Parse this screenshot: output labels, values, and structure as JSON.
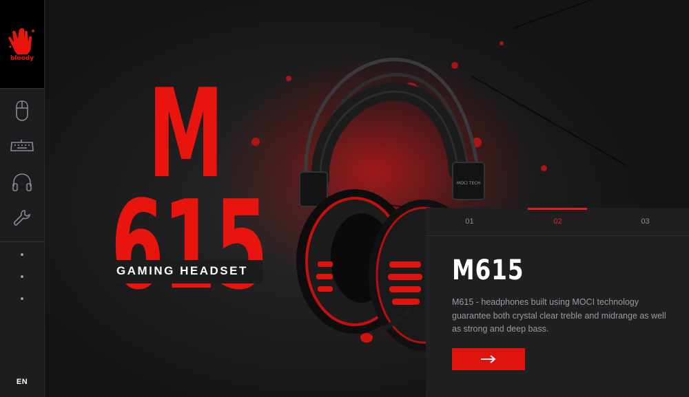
{
  "brand": {
    "logo_text": "bloody",
    "accent": "#e1130e"
  },
  "sidebar": {
    "icons": [
      {
        "name": "mouse-icon"
      },
      {
        "name": "keyboard-icon"
      },
      {
        "name": "headset-icon"
      },
      {
        "name": "wrench-icon"
      }
    ],
    "dots_count": 3,
    "language": "EN"
  },
  "hero": {
    "title_line1": "M",
    "title_line2": "615",
    "subtitle": "GAMING HEADSET",
    "product_brand_mark": "MOCI TECH"
  },
  "panel": {
    "tabs": [
      {
        "label": "01",
        "active": false
      },
      {
        "label": "02",
        "active": true
      },
      {
        "label": "03",
        "active": false
      }
    ],
    "title": "M615",
    "description": "M615 - headphones built using MOCI technology guarantee both crystal clear treble and midrange as well as strong and deep bass.",
    "cta_icon": "arrow-right-icon"
  }
}
